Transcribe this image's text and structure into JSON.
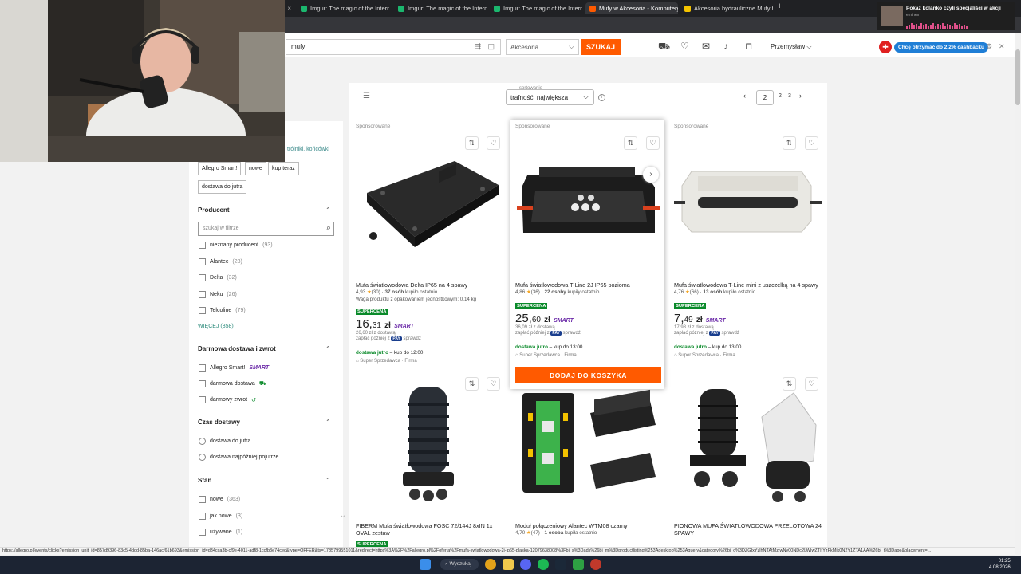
{
  "browser": {
    "tabs": [
      {
        "title": "Imgur: The magic of the Interne",
        "close": "×",
        "favicon_color": "#1bb76e"
      },
      {
        "title": "Imgur: The magic of the Interne",
        "close": "×",
        "favicon_color": "#1bb76e"
      },
      {
        "title": "Imgur: The magic of the Interne",
        "close": "×",
        "favicon_color": "#1bb76e"
      },
      {
        "title": "Mufy w Akcesoria - Komputery",
        "close": "×",
        "favicon_color": "#ff5a00"
      },
      {
        "title": "Akcesoria hydrauliczne Mufy h",
        "close": "×",
        "favicon_color": "#f5c400"
      }
    ],
    "new_tab": "+"
  },
  "header": {
    "search_value": "mufy",
    "search_icons": "⇶ ◫",
    "category": "Akcesoria",
    "search_button": "SZUKAJ",
    "user_name": "Przemysław",
    "user_chevron": "⌵",
    "cashback": "Chcę otrzymać do 2.2% cashbacku",
    "cashback_icon": "✚",
    "settings_icon": "⚙",
    "close_icon": "✕"
  },
  "sort": {
    "label": "sortowanie",
    "value": "trafność: największa",
    "chevron": "⌵",
    "info": "i"
  },
  "pagination": {
    "prev": "‹",
    "current": "2",
    "page2": "2",
    "page3": "3",
    "next": "›"
  },
  "filters": {
    "breadcrumb_tail": "trójniki, końcówki",
    "chips": [
      "Allegro Smart!",
      "nowe",
      "kup teraz",
      "dostawa do jutra"
    ],
    "producer": {
      "title": "Producent",
      "search_placeholder": "szukaj w filtrze",
      "items": [
        {
          "label": "nieznany producent",
          "count": "(93)"
        },
        {
          "label": "Alantec",
          "count": "(28)"
        },
        {
          "label": "Delta",
          "count": "(32)"
        },
        {
          "label": "Neku",
          "count": "(26)"
        },
        {
          "label": "Telcoline",
          "count": "(79)"
        }
      ],
      "more": "WIĘCEJ (858)"
    },
    "shipping": {
      "title": "Darmowa dostawa i zwrot",
      "items": [
        {
          "label": "Allegro Smart!",
          "badge": "SMART"
        },
        {
          "label": "darmowa dostawa",
          "badge": "⛟"
        },
        {
          "label": "darmowy zwrot",
          "badge": "↺"
        }
      ]
    },
    "delivery_time": {
      "title": "Czas dostawy",
      "items": [
        {
          "label": "dostawa do jutra"
        },
        {
          "label": "dostawa najpóźniej pojutrze"
        }
      ]
    },
    "condition": {
      "title": "Stan",
      "items": [
        {
          "label": "nowe",
          "count": "(363)"
        },
        {
          "label": "jak nowe",
          "count": "(3)"
        },
        {
          "label": "używane",
          "count": "(1)"
        }
      ]
    },
    "chevron": "⌃"
  },
  "products": [
    {
      "sponsored": "Sponsorowane",
      "title": "Mufa światłowodowa Delta IP65 na 4 spawy",
      "rating_value": "4,93",
      "rating_count": "(30)",
      "buyers": "37 osób",
      "buyers_suffix": "kupiło ostatnio",
      "note": "Waga produktu z opakowaniem jednostkowym: 0.14 kg",
      "badge": "SUPERCENA",
      "price_int": "16,",
      "price_dec": "31",
      "currency": "zł",
      "smart": "SMART",
      "with_delivery": "26,60 zł z dostawą",
      "pay_later": "zapłać później z",
      "pay": "PAY",
      "pay_check": "sprawdź",
      "delivery_label": "dostawa jutro",
      "delivery_time": "kup do 12:00",
      "seller": "Super Sprzedawca",
      "seller_type": "Firma"
    },
    {
      "sponsored": "Sponsorowane",
      "title": "Mufa światłowodowa T-Line 2J IP65 pozioma",
      "rating_value": "4,86",
      "rating_count": "(36)",
      "buyers": "22 osoby",
      "buyers_suffix": "kupiły ostatnio",
      "badge": "SUPERCENA",
      "price_int": "25,",
      "price_dec": "60",
      "currency": "zł",
      "smart": "SMART",
      "with_delivery": "36,09 zł z dostawą",
      "pay_later": "zapłać później z",
      "pay": "PAY",
      "pay_check": "sprawdź",
      "delivery_label": "dostawa jutro",
      "delivery_time": "kup do 13:00",
      "seller": "Super Sprzedawca",
      "seller_type": "Firma",
      "cart_button": "DODAJ DO KOSZYKA"
    },
    {
      "sponsored": "Sponsorowane",
      "title": "Mufa światłowodowa T-Line mini z uszczelką na 4 spawy",
      "rating_value": "4,76",
      "rating_count": "(66)",
      "buyers": "13 osób",
      "buyers_suffix": "kupiło ostatnio",
      "badge": "SUPERCENA",
      "price_int": "7,",
      "price_dec": "49",
      "currency": "zł",
      "smart": "SMART",
      "with_delivery": "17,98 zł z dostawą",
      "pay_later": "zapłać później z",
      "pay": "PAY",
      "pay_check": "sprawdź",
      "delivery_label": "dostawa jutro",
      "delivery_time": "kup do 13:00",
      "seller": "Super Sprzedawca",
      "seller_type": "Firma"
    },
    {
      "title": "FIBERM Mufa światłowodowa FOSC 72/144J 8xIN 1x OVAL zestaw",
      "badge": "SUPERCENA"
    },
    {
      "title": "Moduł połączeniowy Alantec WTM08 czarny",
      "rating_value": "4,70",
      "rating_count": "(47)",
      "buyers": "1 osoba",
      "buyers_suffix": "kupiła ostatnio"
    },
    {
      "title": "PIONOWA MUFA ŚWIATŁOWODOWA PRZELOTOWA 24 SPAWY"
    }
  ],
  "card_icons": {
    "compare": "⇅",
    "heart": "♡",
    "info": "i",
    "next": "›",
    "star": "★"
  },
  "status_url": "https://allegro.pl/events/clicks?emission_unit_id=857d9396-83c5-4ddd-85ba-146acf61b693&emission_id=d34cca3b-cf9e-4011-adf8-1ccfb3e74cec&type=OFFER&ts=1785799551011&redirect=https%3A%2F%2Fallegro.pl%2Foferta%2Fmufa-swiatlowodowa-2j-ip65-plaska-12079638008%3Fbi_s%3Dads%26bi_m%3Dproductlisting%253Adesktop%253Aquery&category%26bi_c%3DZGIxYzlhNTAtMzIwNy00NDc2LWIwZTItYzFkMjk0N2Y1ZTA1AA%26bi_t%3Dape&placement=...",
  "notification": {
    "title": "Pokaż kolanko czyli specjaliści w akcji",
    "source": "eminem"
  },
  "taskbar": {
    "search": "Wyszukaj",
    "time": "01:25",
    "date": "4.08.2026"
  }
}
